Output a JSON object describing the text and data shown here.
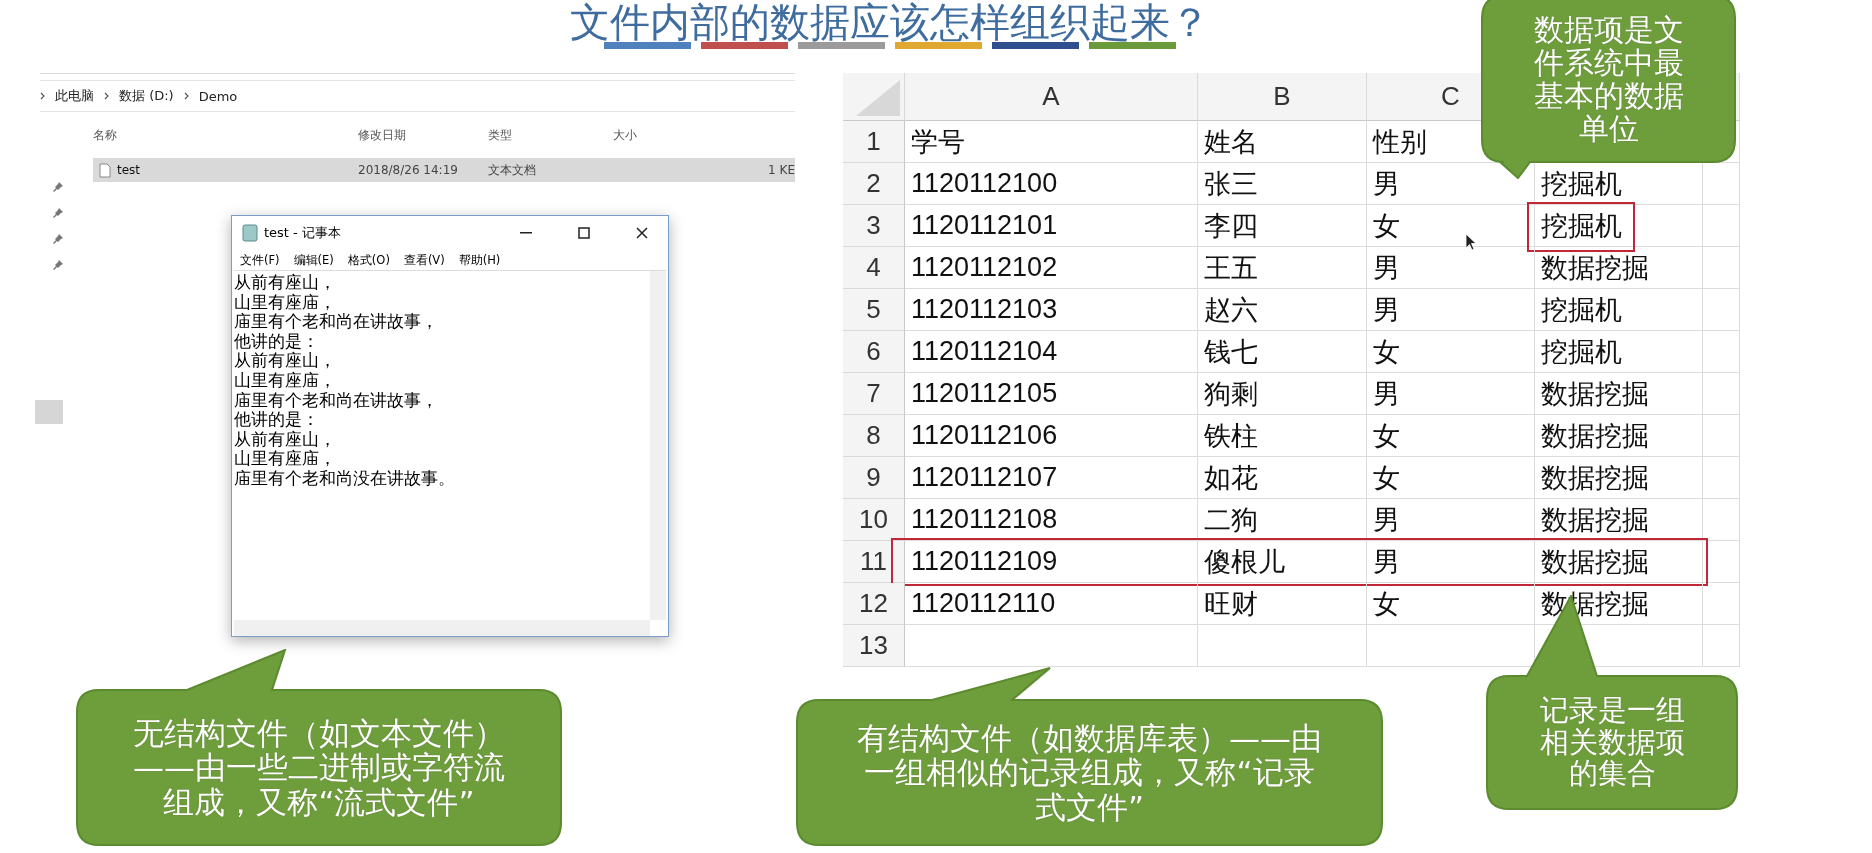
{
  "slide": {
    "title": "文件内部的数据应该怎样组织起来？",
    "accent_bars": [
      {
        "color": "#4f81bd"
      },
      {
        "color": "#c0504d"
      },
      {
        "color": "#9b9b9b"
      },
      {
        "color": "#e0a830"
      },
      {
        "color": "#2f4f8f"
      },
      {
        "color": "#6a9a3a"
      }
    ]
  },
  "explorer": {
    "breadcrumb": [
      "此电脑",
      "数据 (D:)",
      "Demo"
    ],
    "columns": [
      "名称",
      "修改日期",
      "类型",
      "大小"
    ],
    "files": [
      {
        "name": "test",
        "modified": "2018/8/26 14:19",
        "type": "文本文档",
        "size": "1 KE",
        "selected": true
      }
    ]
  },
  "notepad": {
    "title": "test - 记事本",
    "menu": [
      "文件(F)",
      "编辑(E)",
      "格式(O)",
      "查看(V)",
      "帮助(H)"
    ],
    "lines": [
      "从前有座山，",
      "山里有座庙，",
      "庙里有个老和尚在讲故事，",
      "他讲的是：",
      "从前有座山，",
      "山里有座庙，",
      "庙里有个老和尚在讲故事，",
      "他讲的是：",
      "从前有座山，",
      "山里有座庙，",
      "庙里有个老和尚没在讲故事。"
    ]
  },
  "spreadsheet": {
    "columns": [
      "A",
      "B",
      "C"
    ],
    "rows": [
      {
        "number": "1",
        "cells": [
          "学号",
          "姓名",
          "性别"
        ],
        "row_boxed": false,
        "last_cell_boxed": false
      },
      {
        "number": "2",
        "cells": [
          "1120112100",
          "张三",
          "男",
          "挖掘机"
        ],
        "row_boxed": false,
        "last_cell_boxed": false
      },
      {
        "number": "3",
        "cells": [
          "1120112101",
          "李四",
          "女",
          "挖掘机"
        ],
        "row_boxed": false,
        "last_cell_boxed": true
      },
      {
        "number": "4",
        "cells": [
          "1120112102",
          "王五",
          "男",
          "数据挖掘"
        ],
        "row_boxed": false,
        "last_cell_boxed": false
      },
      {
        "number": "5",
        "cells": [
          "1120112103",
          "赵六",
          "男",
          "挖掘机"
        ],
        "row_boxed": false,
        "last_cell_boxed": false
      },
      {
        "number": "6",
        "cells": [
          "1120112104",
          "钱七",
          "女",
          "挖掘机"
        ],
        "row_boxed": false,
        "last_cell_boxed": false
      },
      {
        "number": "7",
        "cells": [
          "1120112105",
          "狗剩",
          "男",
          "数据挖掘"
        ],
        "row_boxed": false,
        "last_cell_boxed": false
      },
      {
        "number": "8",
        "cells": [
          "1120112106",
          "铁柱",
          "女",
          "数据挖掘"
        ],
        "row_boxed": false,
        "last_cell_boxed": false
      },
      {
        "number": "9",
        "cells": [
          "1120112107",
          "如花",
          "女",
          "数据挖掘"
        ],
        "row_boxed": false,
        "last_cell_boxed": false
      },
      {
        "number": "10",
        "cells": [
          "1120112108",
          "二狗",
          "男",
          "数据挖掘"
        ],
        "row_boxed": false,
        "last_cell_boxed": false
      },
      {
        "number": "11",
        "cells": [
          "1120112109",
          "傻根儿",
          "男",
          "数据挖掘"
        ],
        "row_boxed": true,
        "last_cell_boxed": false
      },
      {
        "number": "12",
        "cells": [
          "1120112110",
          "旺财",
          "女",
          "数据挖掘"
        ],
        "row_boxed": false,
        "last_cell_boxed": false
      },
      {
        "number": "13",
        "cells": [],
        "row_boxed": false,
        "last_cell_boxed": false
      }
    ]
  },
  "callouts": [
    {
      "kind": "field_note",
      "text": "数据项是文件系统中最基本的数据单位"
    },
    {
      "kind": "unstructured",
      "text": "无结构文件（如文本文件）——由一些二进制或字符流组成，又称“流式文件”"
    },
    {
      "kind": "structured",
      "text": "有结构文件（如数据库表）——由一组相似的记录组成，又称“记录式文件”"
    },
    {
      "kind": "record_note",
      "text": "记录是一组相关数据项的集合"
    }
  ]
}
